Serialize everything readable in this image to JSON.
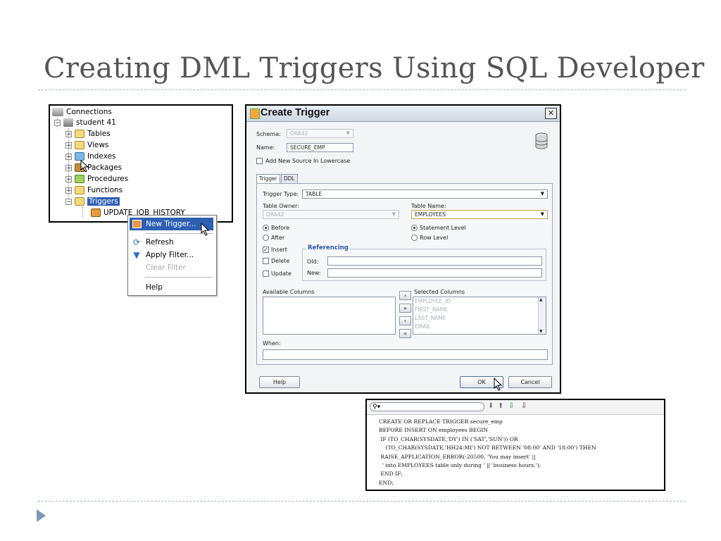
{
  "slide": {
    "title": "Creating DML Triggers Using SQL Developer"
  },
  "tree": {
    "root": "Connections",
    "connection": "student 41",
    "items": [
      "Tables",
      "Views",
      "Indexes",
      "Packages",
      "Procedures",
      "Functions",
      "Triggers"
    ],
    "child": "UPDATE_JOB_HISTORY"
  },
  "context_menu": {
    "items": [
      {
        "label": "New Trigger...",
        "icon": "new-trigger-icon"
      },
      {
        "label": "Refresh",
        "icon": "refresh-icon"
      },
      {
        "label": "Apply Filter...",
        "icon": "filter-icon"
      },
      {
        "label": "Clear Filter",
        "icon": ""
      },
      {
        "label": "Help",
        "icon": ""
      }
    ]
  },
  "dialog": {
    "title": "Create Trigger",
    "schema_label": "Schema:",
    "schema_value": "ORA42",
    "name_label": "Name:",
    "name_value": "SECURE_EMP",
    "lowercase_label": "Add New Source In Lowercase",
    "tabs": [
      "Trigger",
      "DDL"
    ],
    "trigger_type_label": "Trigger Type:",
    "trigger_type_value": "TABLE",
    "table_owner_label": "Table Owner:",
    "table_owner_value": "ORA42",
    "table_name_label": "Table Name:",
    "table_name_value": "EMPLOYEES",
    "before_label": "Before",
    "after_label": "After",
    "statement_level_label": "Statement Level",
    "row_level_label": "Row Level",
    "insert_label": "Insert",
    "delete_label": "Delete",
    "update_label": "Update",
    "referencing_label": "Referencing",
    "old_label": "Old:",
    "new_label": "New:",
    "available_columns_label": "Available Columns",
    "selected_columns_label": "Selected Columns",
    "selected_columns": [
      "EMPLOYEE_ID",
      "FIRST_NAME",
      "LAST_NAME",
      "EMAIL"
    ],
    "when_label": "When:",
    "help_button": "Help",
    "ok_button": "OK",
    "cancel_button": "Cancel"
  },
  "code": {
    "search_icon": "binoculars-icon",
    "lines": [
      "CREATE OR REPLACE TRIGGER secure_emp",
      "BEFORE INSERT ON employees BEGIN",
      " IF (TO_CHAR(SYSDATE,'DY') IN ('SAT','SUN')) OR",
      "    (TO_CHAR(SYSDATE,'HH24:MI') NOT BETWEEN '08:00' AND '18:00') THEN",
      " RAISE_APPLICATION_ERROR(-20500, 'You may insert' ||",
      "  ' into EMPLOYEES table only during ' ||' business hours.');",
      " END IF;",
      "END;"
    ]
  }
}
